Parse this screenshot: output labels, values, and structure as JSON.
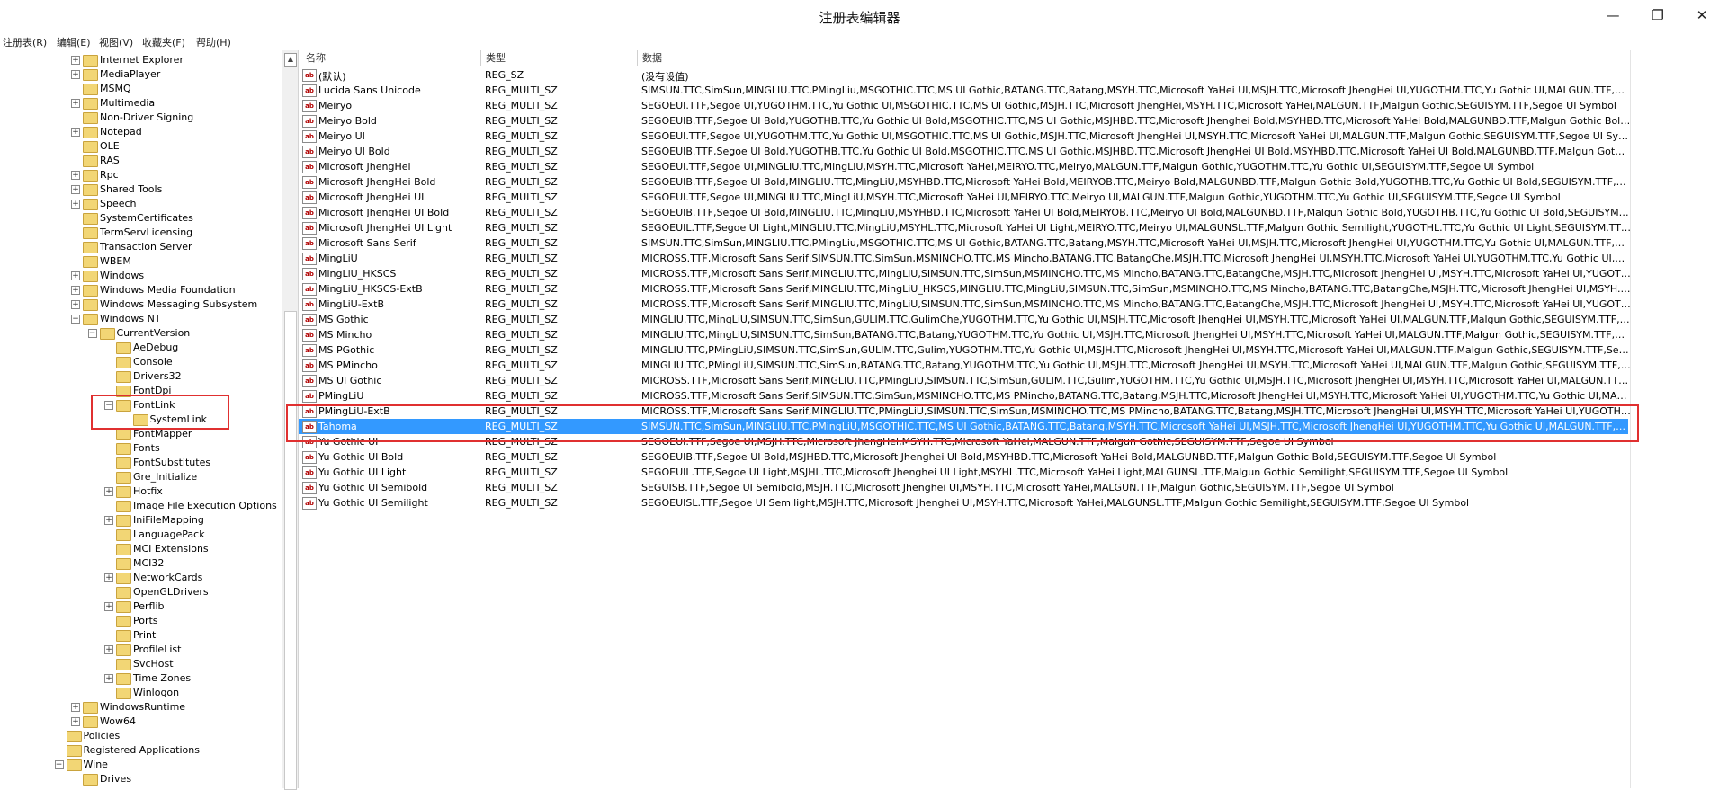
{
  "window": {
    "title": "注册表编辑器",
    "minimize_glyph": "—",
    "maximize_glyph": "❐",
    "close_glyph": "✕"
  },
  "menu": [
    "注册表(R)",
    "编辑(E)",
    "视图(V)",
    "收藏夹(F)",
    "帮助(H)"
  ],
  "tree": [
    {
      "label": "Internet Explorer",
      "expandable": true,
      "depth": 2
    },
    {
      "label": "MediaPlayer",
      "expandable": true,
      "depth": 2
    },
    {
      "label": "MSMQ",
      "expandable": false,
      "depth": 2
    },
    {
      "label": "Multimedia",
      "expandable": true,
      "depth": 2
    },
    {
      "label": "Non-Driver Signing",
      "expandable": false,
      "depth": 2
    },
    {
      "label": "Notepad",
      "expandable": true,
      "depth": 2
    },
    {
      "label": "OLE",
      "expandable": false,
      "depth": 2
    },
    {
      "label": "RAS",
      "expandable": false,
      "depth": 2
    },
    {
      "label": "Rpc",
      "expandable": true,
      "depth": 2
    },
    {
      "label": "Shared Tools",
      "expandable": true,
      "depth": 2
    },
    {
      "label": "Speech",
      "expandable": true,
      "depth": 2
    },
    {
      "label": "SystemCertificates",
      "expandable": false,
      "depth": 2
    },
    {
      "label": "TermServLicensing",
      "expandable": false,
      "depth": 2
    },
    {
      "label": "Transaction Server",
      "expandable": false,
      "depth": 2
    },
    {
      "label": "WBEM",
      "expandable": false,
      "depth": 2
    },
    {
      "label": "Windows",
      "expandable": true,
      "depth": 2
    },
    {
      "label": "Windows Media Foundation",
      "expandable": true,
      "depth": 2
    },
    {
      "label": "Windows Messaging Subsystem",
      "expandable": true,
      "depth": 2
    },
    {
      "label": "Windows NT",
      "expandable": true,
      "expanded": true,
      "depth": 2
    },
    {
      "label": "CurrentVersion",
      "expandable": true,
      "expanded": true,
      "depth": 3
    },
    {
      "label": "AeDebug",
      "expandable": false,
      "depth": 4
    },
    {
      "label": "Console",
      "expandable": false,
      "depth": 4
    },
    {
      "label": "Drivers32",
      "expandable": false,
      "depth": 4
    },
    {
      "label": "FontDpi",
      "expandable": false,
      "depth": 4
    },
    {
      "label": "FontLink",
      "expandable": true,
      "expanded": true,
      "depth": 4
    },
    {
      "label": "SystemLink",
      "expandable": false,
      "depth": 5,
      "open": true
    },
    {
      "label": "FontMapper",
      "expandable": false,
      "depth": 4
    },
    {
      "label": "Fonts",
      "expandable": false,
      "depth": 4
    },
    {
      "label": "FontSubstitutes",
      "expandable": false,
      "depth": 4
    },
    {
      "label": "Gre_Initialize",
      "expandable": false,
      "depth": 4
    },
    {
      "label": "Hotfix",
      "expandable": true,
      "depth": 4
    },
    {
      "label": "Image File Execution Options",
      "expandable": false,
      "depth": 4
    },
    {
      "label": "IniFileMapping",
      "expandable": true,
      "depth": 4
    },
    {
      "label": "LanguagePack",
      "expandable": false,
      "depth": 4
    },
    {
      "label": "MCI Extensions",
      "expandable": false,
      "depth": 4
    },
    {
      "label": "MCI32",
      "expandable": false,
      "depth": 4
    },
    {
      "label": "NetworkCards",
      "expandable": true,
      "depth": 4
    },
    {
      "label": "OpenGLDrivers",
      "expandable": false,
      "depth": 4
    },
    {
      "label": "Perflib",
      "expandable": true,
      "depth": 4
    },
    {
      "label": "Ports",
      "expandable": false,
      "depth": 4
    },
    {
      "label": "Print",
      "expandable": false,
      "depth": 4
    },
    {
      "label": "ProfileList",
      "expandable": true,
      "depth": 4
    },
    {
      "label": "SvcHost",
      "expandable": false,
      "depth": 4
    },
    {
      "label": "Time Zones",
      "expandable": true,
      "depth": 4
    },
    {
      "label": "Winlogon",
      "expandable": false,
      "depth": 4
    },
    {
      "label": "WindowsRuntime",
      "expandable": true,
      "depth": 2
    },
    {
      "label": "Wow64",
      "expandable": true,
      "depth": 2
    },
    {
      "label": "Policies",
      "expandable": false,
      "depth": 1
    },
    {
      "label": "Registered Applications",
      "expandable": false,
      "depth": 1
    },
    {
      "label": "Wine",
      "expandable": true,
      "expanded": true,
      "depth": 1
    },
    {
      "label": "Drives",
      "expandable": false,
      "depth": 2
    }
  ],
  "columns": {
    "name": "名称",
    "type": "类型",
    "data": "数据"
  },
  "values": [
    {
      "name": "(默认)",
      "type": "REG_SZ",
      "data": "(没有设值)"
    },
    {
      "name": "Lucida Sans Unicode",
      "type": "REG_MULTI_SZ",
      "data": "SIMSUN.TTC,SimSun,MINGLIU.TTC,PMingLiu,MSGOTHIC.TTC,MS UI Gothic,BATANG.TTC,Batang,MSYH.TTC,Microsoft YaHei UI,MSJH.TTC,Microsoft JhengHei UI,YUGOTHM.TTC,Yu Gothic UI,MALGUN.TTF,Malgun Gothic,SEGUIS..."
    },
    {
      "name": "Meiryo",
      "type": "REG_MULTI_SZ",
      "data": "SEGOEUI.TTF,Segoe UI,YUGOTHM.TTC,Yu Gothic UI,MSGOTHIC.TTC,MS UI Gothic,MSJH.TTC,Microsoft JhengHei,MSYH.TTC,Microsoft YaHei,MALGUN.TTF,Malgun Gothic,SEGUISYM.TTF,Segoe UI Symbol"
    },
    {
      "name": "Meiryo Bold",
      "type": "REG_MULTI_SZ",
      "data": "SEGOEUIB.TTF,Segoe UI Bold,YUGOTHB.TTC,Yu Gothic UI Bold,MSGOTHIC.TTC,MS UI Gothic,MSJHBD.TTC,Microsoft Jhenghei Bold,MSYHBD.TTC,Microsoft YaHei Bold,MALGUNBD.TTF,Malgun Gothic Bold,SEGUISYM.TTF,Segoe ..."
    },
    {
      "name": "Meiryo UI",
      "type": "REG_MULTI_SZ",
      "data": "SEGOEUI.TTF,Segoe UI,YUGOTHM.TTC,Yu Gothic UI,MSGOTHIC.TTC,MS UI Gothic,MSJH.TTC,Microsoft JhengHei UI,MSYH.TTC,Microsoft YaHei UI,MALGUN.TTF,Malgun Gothic,SEGUISYM.TTF,Segoe UI Symbol"
    },
    {
      "name": "Meiryo UI Bold",
      "type": "REG_MULTI_SZ",
      "data": "SEGOEUIB.TTF,Segoe UI Bold,YUGOTHB.TTC,Yu Gothic UI Bold,MSGOTHIC.TTC,MS UI Gothic,MSJHBD.TTC,Microsoft JhengHei UI Bold,MSYHBD.TTC,Microsoft YaHei UI Bold,MALGUNBD.TTF,Malgun Gothic Bold,SEGUISYM.TTF,S..."
    },
    {
      "name": "Microsoft JhengHei",
      "type": "REG_MULTI_SZ",
      "data": "SEGOEUI.TTF,Segoe UI,MINGLIU.TTC,MingLiU,MSYH.TTC,Microsoft YaHei,MEIRYO.TTC,Meiryo,MALGUN.TTF,Malgun Gothic,YUGOTHM.TTC,Yu Gothic UI,SEGUISYM.TTF,Segoe UI Symbol"
    },
    {
      "name": "Microsoft JhengHei Bold",
      "type": "REG_MULTI_SZ",
      "data": "SEGOEUIB.TTF,Segoe UI Bold,MINGLIU.TTC,MingLiU,MSYHBD.TTC,Microsoft YaHei Bold,MEIRYOB.TTC,Meiryo Bold,MALGUNBD.TTF,Malgun Gothic Bold,YUGOTHB.TTC,Yu Gothic UI Bold,SEGUISYM.TTF,Segoe UI Symbol"
    },
    {
      "name": "Microsoft JhengHei UI",
      "type": "REG_MULTI_SZ",
      "data": "SEGOEUI.TTF,Segoe UI,MINGLIU.TTC,MingLiU,MSYH.TTC,Microsoft YaHei UI,MEIRYO.TTC,Meiryo UI,MALGUN.TTF,Malgun Gothic,YUGOTHM.TTC,Yu Gothic UI,SEGUISYM.TTF,Segoe UI Symbol"
    },
    {
      "name": "Microsoft JhengHei UI Bold",
      "type": "REG_MULTI_SZ",
      "data": "SEGOEUIB.TTF,Segoe UI Bold,MINGLIU.TTC,MingLiU,MSYHBD.TTC,Microsoft YaHei UI Bold,MEIRYOB.TTC,Meiryo UI Bold,MALGUNBD.TTF,Malgun Gothic Bold,YUGOTHB.TTC,Yu Gothic UI Bold,SEGUISYM.TTF,Segoe UI Symbol"
    },
    {
      "name": "Microsoft JhengHei UI Light",
      "type": "REG_MULTI_SZ",
      "data": "SEGOEUIL.TTF,Segoe UI Light,MINGLIU.TTC,MingLiU,MSYHL.TTC,Microsoft YaHei UI Light,MEIRYO.TTC,Meiryo UI,MALGUNSL.TTF,Malgun Gothic Semilight,YUGOTHL.TTC,Yu Gothic UI Light,SEGUISYM.TTF,Segoe UI Symbol"
    },
    {
      "name": "Microsoft Sans Serif",
      "type": "REG_MULTI_SZ",
      "data": "SIMSUN.TTC,SimSun,MINGLIU.TTC,PMingLiu,MSGOTHIC.TTC,MS UI Gothic,BATANG.TTC,Batang,MSYH.TTC,Microsoft YaHei UI,MSJH.TTC,Microsoft JhengHei UI,YUGOTHM.TTC,Yu Gothic UI,MALGUN.TTF,Malgun Gothic,SEGUISY..."
    },
    {
      "name": "MingLiU",
      "type": "REG_MULTI_SZ",
      "data": "MICROSS.TTF,Microsoft Sans Serif,SIMSUN.TTC,SimSun,MSMINCHO.TTC,MS Mincho,BATANG.TTC,BatangChe,MSJH.TTC,Microsoft JhengHei UI,MSYH.TTC,Microsoft YaHei UI,YUGOTHM.TTC,Yu Gothic UI,MALGUN.TTF,Malgun G..."
    },
    {
      "name": "MingLiU_HKSCS",
      "type": "REG_MULTI_SZ",
      "data": "MICROSS.TTF,Microsoft Sans Serif,MINGLIU.TTC,MingLiU,SIMSUN.TTC,SimSun,MSMINCHO.TTC,MS Mincho,BATANG.TTC,BatangChe,MSJH.TTC,Microsoft JhengHei UI,MSYH.TTC,Microsoft YaHei UI,YUGOTHM.TTC,Yu Gothic UI,..."
    },
    {
      "name": "MingLiU_HKSCS-ExtB",
      "type": "REG_MULTI_SZ",
      "data": "MICROSS.TTF,Microsoft Sans Serif,MINGLIU.TTC,MingLiU_HKSCS,MINGLIU.TTC,MingLiU,SIMSUN.TTC,SimSun,MSMINCHO.TTC,MS Mincho,BATANG.TTC,BatangChe,MSJH.TTC,Microsoft JhengHei UI,MSYH.TTC,Microsoft YaHei UI,..."
    },
    {
      "name": "MingLiU-ExtB",
      "type": "REG_MULTI_SZ",
      "data": "MICROSS.TTF,Microsoft Sans Serif,MINGLIU.TTC,MingLiU,SIMSUN.TTC,SimSun,MSMINCHO.TTC,MS Mincho,BATANG.TTC,BatangChe,MSJH.TTC,Microsoft JhengHei UI,MSYH.TTC,Microsoft YaHei UI,YUGOTHM.TTC,Yu Gothic UI,..."
    },
    {
      "name": "MS Gothic",
      "type": "REG_MULTI_SZ",
      "data": "MINGLIU.TTC,MingLiU,SIMSUN.TTC,SimSun,GULIM.TTC,GulimChe,YUGOTHM.TTC,Yu Gothic UI,MSJH.TTC,Microsoft JhengHei UI,MSYH.TTC,Microsoft YaHei UI,MALGUN.TTF,Malgun Gothic,SEGUISYM.TTF,Segoe UI Symbol"
    },
    {
      "name": "MS Mincho",
      "type": "REG_MULTI_SZ",
      "data": "MINGLIU.TTC,MingLiU,SIMSUN.TTC,SimSun,BATANG.TTC,Batang,YUGOTHM.TTC,Yu Gothic UI,MSJH.TTC,Microsoft JhengHei UI,MSYH.TTC,Microsoft YaHei UI,MALGUN.TTF,Malgun Gothic,SEGUISYM.TTF,Segoe UI Symbol"
    },
    {
      "name": "MS PGothic",
      "type": "REG_MULTI_SZ",
      "data": "MINGLIU.TTC,PMingLiU,SIMSUN.TTC,SimSun,GULIM.TTC,Gulim,YUGOTHM.TTC,Yu Gothic UI,MSJH.TTC,Microsoft JhengHei UI,MSYH.TTC,Microsoft YaHei UI,MALGUN.TTF,Malgun Gothic,SEGUISYM.TTF,Segoe UI Symbol"
    },
    {
      "name": "MS PMincho",
      "type": "REG_MULTI_SZ",
      "data": "MINGLIU.TTC,PMingLiU,SIMSUN.TTC,SimSun,BATANG.TTC,Batang,YUGOTHM.TTC,Yu Gothic UI,MSJH.TTC,Microsoft JhengHei UI,MSYH.TTC,Microsoft YaHei UI,MALGUN.TTF,Malgun Gothic,SEGUISYM.TTF,Segoe UI Symbol"
    },
    {
      "name": "MS UI Gothic",
      "type": "REG_MULTI_SZ",
      "data": "MICROSS.TTF,Microsoft Sans Serif,MINGLIU.TTC,PMingLiU,SIMSUN.TTC,SimSun,GULIM.TTC,Gulim,YUGOTHM.TTC,Yu Gothic UI,MSJH.TTC,Microsoft JhengHei UI,MSYH.TTC,Microsoft YaHei UI,MALGUN.TTF,Malgun Gothic,SEGU..."
    },
    {
      "name": "PMingLiU",
      "type": "REG_MULTI_SZ",
      "data": "MICROSS.TTF,Microsoft Sans Serif,SIMSUN.TTC,SimSun,MSMINCHO.TTC,MS PMincho,BATANG.TTC,Batang,MSJH.TTC,Microsoft JhengHei UI,MSYH.TTC,Microsoft YaHei UI,YUGOTHM.TTC,Yu Gothic UI,MALGUN.TTF,Malgun Got..."
    },
    {
      "name": "PMingLiU-ExtB",
      "type": "REG_MULTI_SZ",
      "data": "MICROSS.TTF,Microsoft Sans Serif,MINGLIU.TTC,PMingLiU,SIMSUN.TTC,SimSun,MSMINCHO.TTC,MS PMincho,BATANG.TTC,Batang,MSJH.TTC,Microsoft JhengHei UI,MSYH.TTC,Microsoft YaHei UI,YUGOTHM.TTC,Yu Gothic UI,M..."
    },
    {
      "name": "Tahoma",
      "type": "REG_MULTI_SZ",
      "data": "SIMSUN.TTC,SimSun,MINGLIU.TTC,PMingLiU,MSGOTHIC.TTC,MS UI Gothic,BATANG.TTC,Batang,MSYH.TTC,Microsoft YaHei UI,MSJH.TTC,Microsoft JhengHei UI,YUGOTHM.TTC,Yu Gothic UI,MALGUN.TTF,Malgun Gothic,SEGUISY...",
      "selected": true
    },
    {
      "name": "Yu Gothic UI",
      "type": "REG_MULTI_SZ",
      "data": "SEGOEUI.TTF,Segoe UI,MSJH.TTC,Microsoft JhengHei,MSYH.TTC,Microsoft YaHei,MALGUN.TTF,Malgun Gothic,SEGUISYM.TTF,Segoe UI Symbol"
    },
    {
      "name": "Yu Gothic UI Bold",
      "type": "REG_MULTI_SZ",
      "data": "SEGOEUIB.TTF,Segoe UI Bold,MSJHBD.TTC,Microsoft Jhenghei UI Bold,MSYHBD.TTC,Microsoft YaHei Bold,MALGUNBD.TTF,Malgun Gothic Bold,SEGUISYM.TTF,Segoe UI Symbol"
    },
    {
      "name": "Yu Gothic UI Light",
      "type": "REG_MULTI_SZ",
      "data": "SEGOEUIL.TTF,Segoe UI Light,MSJHL.TTC,Microsoft Jhenghei UI Light,MSYHL.TTC,Microsoft YaHei Light,MALGUNSL.TTF,Malgun Gothic Semilight,SEGUISYM.TTF,Segoe UI Symbol"
    },
    {
      "name": "Yu Gothic UI Semibold",
      "type": "REG_MULTI_SZ",
      "data": "SEGUISB.TTF,Segoe UI Semibold,MSJH.TTC,Microsoft Jhenghei UI,MSYH.TTC,Microsoft YaHei,MALGUN.TTF,Malgun Gothic,SEGUISYM.TTF,Segoe UI Symbol"
    },
    {
      "name": "Yu Gothic UI Semilight",
      "type": "REG_MULTI_SZ",
      "data": "SEGOEUISL.TTF,Segoe UI Semilight,MSJH.TTC,Microsoft Jhenghei UI,MSYH.TTC,Microsoft YaHei,MALGUNSL.TTF,Malgun Gothic Semilight,SEGUISYM.TTF,Segoe UI Symbol"
    }
  ],
  "value_icon_text": "ab",
  "colors": {
    "selection": "#3399ff",
    "annotation": "#e03030",
    "folder": "#f2d675"
  }
}
